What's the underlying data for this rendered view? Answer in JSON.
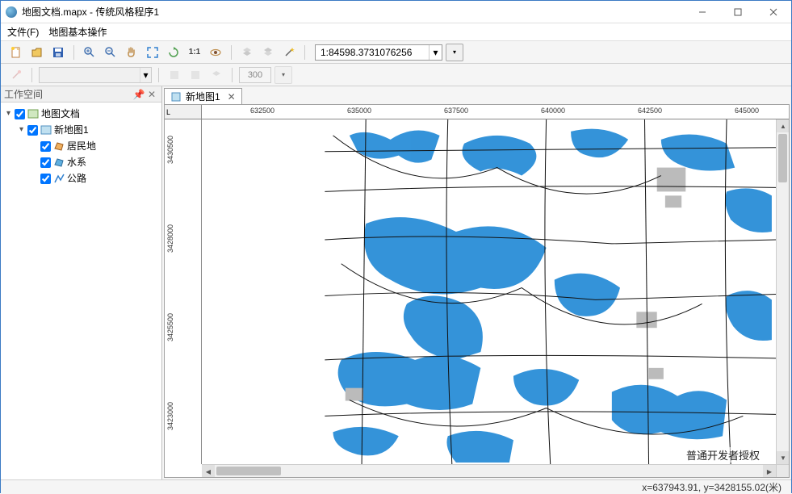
{
  "window": {
    "title": "地图文档.mapx - 传统风格程序1"
  },
  "menu": {
    "file": "文件(F)",
    "mapops": "地图基本操作"
  },
  "toolbar": {
    "scale": "1:84598.3731076256"
  },
  "toolbar2": {
    "num": "300"
  },
  "sidebar": {
    "title": "工作空间",
    "tree": {
      "doc": "地图文档",
      "map": "新地图1",
      "layers": [
        "居民地",
        "水系",
        "公路"
      ]
    }
  },
  "tab": {
    "label": "新地图1"
  },
  "ruler_h": {
    "corner": "L",
    "ticks": [
      "632500",
      "635000",
      "637500",
      "640000",
      "642500",
      "645000"
    ]
  },
  "ruler_v": {
    "ticks": [
      "3430500",
      "3428000",
      "3425500",
      "3423000"
    ]
  },
  "license": "普通开发者授权",
  "status": {
    "coords": "x=637943.91, y=3428155.02(米)"
  }
}
